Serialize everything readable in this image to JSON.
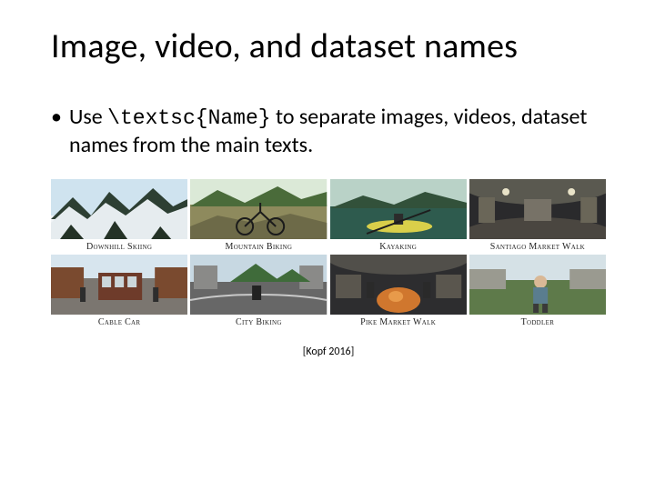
{
  "title": "Image, video, and dataset names",
  "bullet": {
    "pre": "Use ",
    "code": "\\textsc{Name}",
    "post": " to separate images, videos, dataset names from the main texts."
  },
  "gallery": [
    {
      "caption": "Downhill Skiing"
    },
    {
      "caption": "Mountain Biking"
    },
    {
      "caption": "Kayaking"
    },
    {
      "caption": "Santiago Market Walk"
    },
    {
      "caption": "Cable Car"
    },
    {
      "caption": "City Biking"
    },
    {
      "caption": "Pike Market Walk"
    },
    {
      "caption": "Toddler"
    }
  ],
  "citation": "[Kopf 2016]"
}
